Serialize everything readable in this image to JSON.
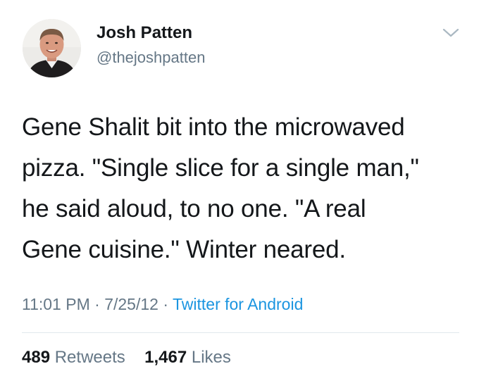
{
  "author": {
    "name": "Josh Patten",
    "handle": "@thejoshpatten"
  },
  "tweet": {
    "lines": [
      "Gene Shalit bit into the microwaved",
      "pizza. \"Single slice for a single man,\"",
      "he said aloud, to no one. \"A real",
      "Gene cuisine.\" Winter neared."
    ],
    "time": "11:01 PM",
    "date": "7/25/12",
    "separator": "·",
    "source": "Twitter for Android"
  },
  "stats": {
    "retweets_count": "489",
    "retweets_label": "Retweets",
    "likes_count": "1,467",
    "likes_label": "Likes"
  },
  "icons": {
    "caret": "chevron-down-icon"
  },
  "colors": {
    "text": "#14171a",
    "secondary": "#657786",
    "link": "#1b95e0",
    "divider": "#e1e8ed"
  }
}
